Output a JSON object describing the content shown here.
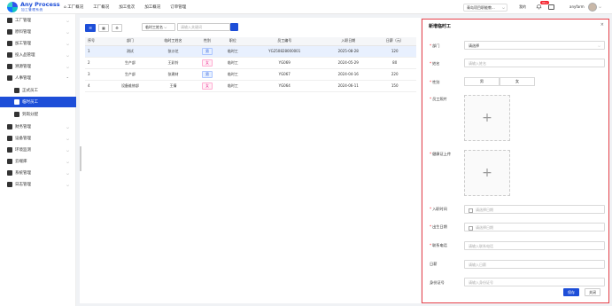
{
  "brand": {
    "name": "Any Process",
    "subtitle": "加工管理系统"
  },
  "topnav": [
    "工厂概况",
    "工厂概况",
    "加工批次",
    "加工概况",
    "订单管理"
  ],
  "header": {
    "project_select": "青岛项目职能教...",
    "project_label": "我的",
    "badge": "99+",
    "username": "anyfarm"
  },
  "sidebar": [
    {
      "label": "工厂管理",
      "chev": "⌵"
    },
    {
      "label": "原料管理",
      "chev": "⌵"
    },
    {
      "label": "加工管理",
      "chev": "⌵"
    },
    {
      "label": "投入品管理",
      "chev": "⌵"
    },
    {
      "label": "溯源管理",
      "chev": "⌵"
    },
    {
      "label": "人事管理",
      "chev": "⌃"
    },
    {
      "label": "正式员工",
      "chev": ""
    },
    {
      "label": "临时员工",
      "chev": ""
    },
    {
      "label": "到岗分配",
      "chev": ""
    },
    {
      "label": "财务管理",
      "chev": "⌵"
    },
    {
      "label": "设备管理",
      "chev": "⌵"
    },
    {
      "label": "环境监测",
      "chev": "⌵"
    },
    {
      "label": "云端库",
      "chev": "⌵"
    },
    {
      "label": "系统管理",
      "chev": "⌵"
    },
    {
      "label": "日志管理",
      "chev": "⌵"
    }
  ],
  "toolbar": {
    "emp_type": "临时工姓名",
    "search_placeholder": "请输入关键词"
  },
  "table": {
    "headers": [
      "序号",
      "部门",
      "临时工姓名",
      "性别",
      "职位",
      "员工编号",
      "入职日期",
      "日薪（元）"
    ],
    "rows": [
      [
        "1",
        "测试",
        "张沙芝",
        "男",
        "临时工",
        "YG250828000001",
        "2025-08-28",
        "120"
      ],
      [
        "2",
        "生产部",
        "王彩铃",
        "女",
        "临时工",
        "YG069",
        "2024-05-29",
        "80"
      ],
      [
        "3",
        "生产部",
        "张建材",
        "男",
        "临时工",
        "YG067",
        "2024-04-16",
        "220"
      ],
      [
        "4",
        "设备维修部",
        "王倩",
        "女",
        "临时工",
        "YG064",
        "2024-06-11",
        "150"
      ]
    ]
  },
  "panel": {
    "title": "新增临时工",
    "dept_label": "部门",
    "dept_value": "请选择",
    "name_label": "姓名",
    "name_placeholder": "请输入姓名",
    "gender_label": "性别",
    "gender_male": "男",
    "gender_female": "女",
    "photo_label": "员工照片",
    "cert_label": "健康证上传",
    "join_label": "入职时间",
    "join_placeholder": "请选择日期",
    "leave_label": "出生日期",
    "leave_placeholder": "请选择日期",
    "phone_label": "联系电话",
    "phone_placeholder": "请输入联系电话",
    "wage_label": "日薪",
    "wage_placeholder": "请输入日薪",
    "id_label": "身份证号",
    "id_placeholder": "请输入身份证号",
    "save": "保存",
    "close": "关闭"
  }
}
